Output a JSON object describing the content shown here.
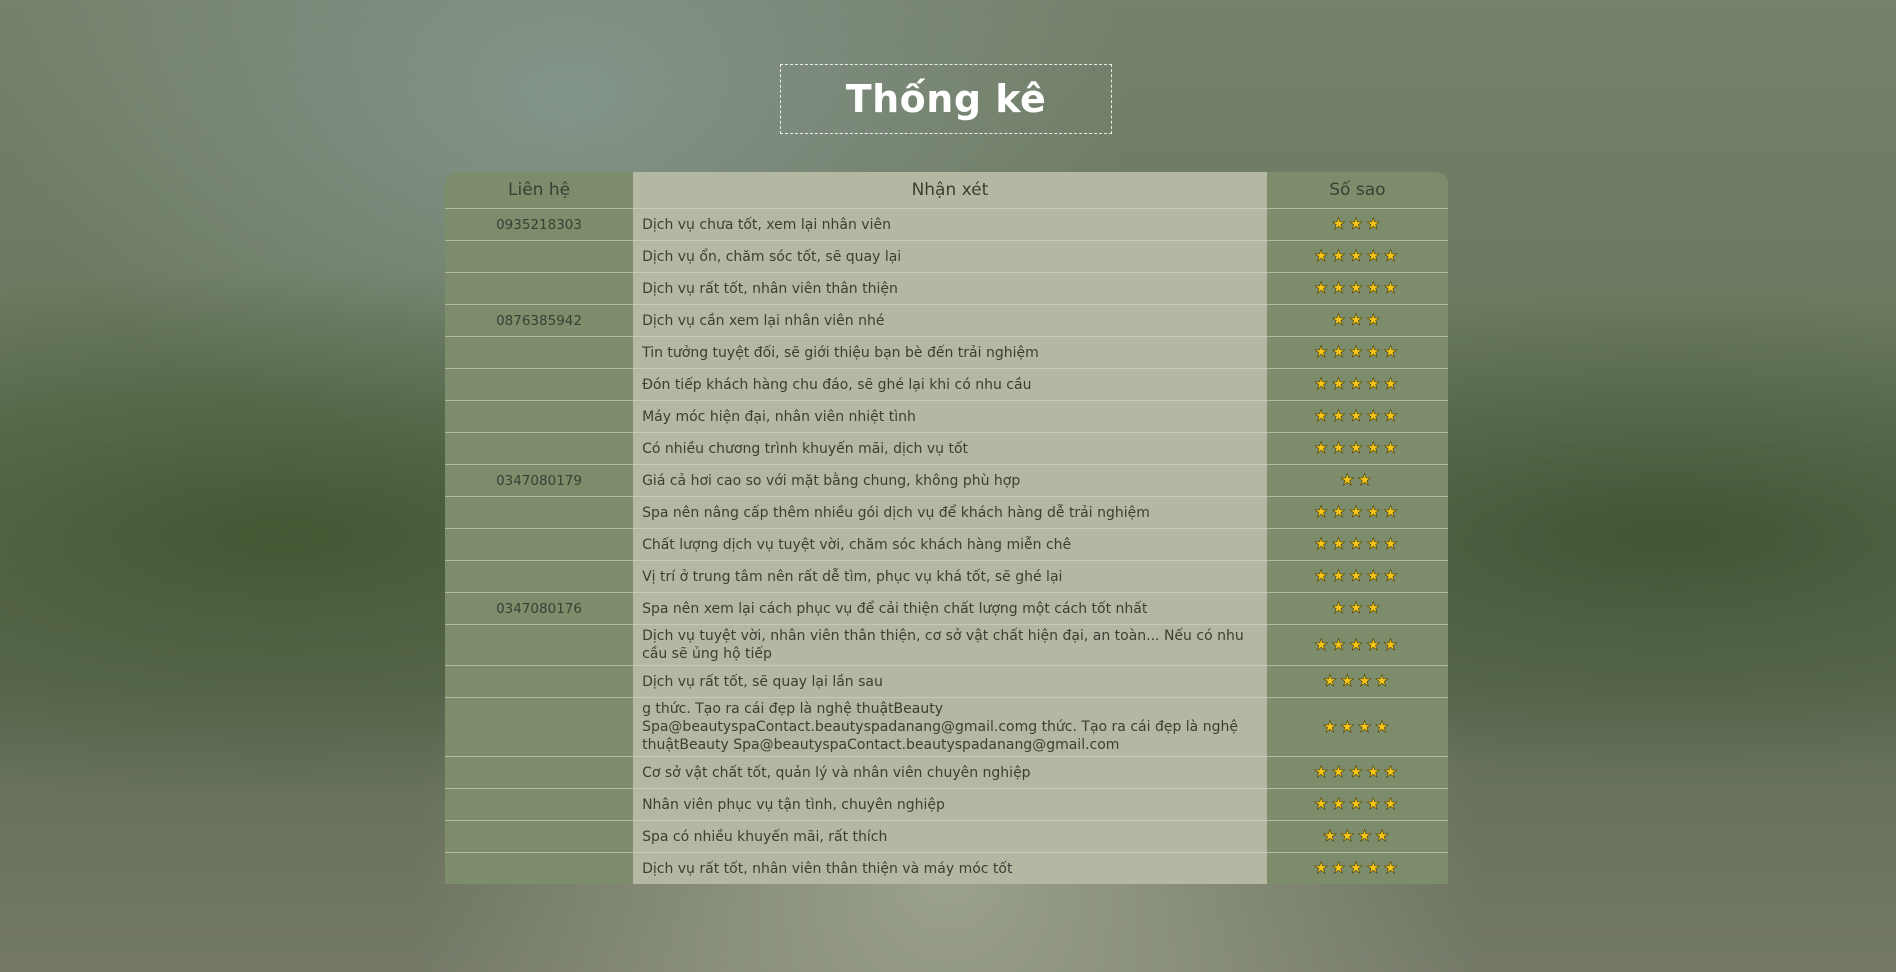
{
  "page": {
    "title": "Thống kê"
  },
  "table": {
    "headers": {
      "contact": "Liên hệ",
      "review": "Nhận xét",
      "stars": "Số sao"
    },
    "rows": [
      {
        "contact": "0935218303",
        "review": "Dịch vụ chưa tốt, xem lại nhân viên",
        "stars": 3,
        "stars_text": "★★★"
      },
      {
        "contact": "",
        "review": "Dịch vụ ổn, chăm sóc tốt, sẽ quay lại",
        "stars": 5,
        "stars_text": "★★★★★"
      },
      {
        "contact": "",
        "review": "Dịch vụ rất tốt, nhân viên thân thiện",
        "stars": 5,
        "stars_text": "★★★★★"
      },
      {
        "contact": "0876385942",
        "review": "Dịch vụ cần xem lại nhân viên nhé",
        "stars": 3,
        "stars_text": "★★★"
      },
      {
        "contact": "",
        "review": "Tin tưởng tuyệt đối, sẽ giới thiệu bạn bè đến trải nghiệm",
        "stars": 5,
        "stars_text": "★★★★★"
      },
      {
        "contact": "",
        "review": "Đón tiếp khách hàng chu đáo, sẽ ghé lại khi có nhu cầu",
        "stars": 5,
        "stars_text": "★★★★★"
      },
      {
        "contact": "",
        "review": "Máy móc hiện đại, nhân viên nhiệt tình",
        "stars": 5,
        "stars_text": "★★★★★"
      },
      {
        "contact": "",
        "review": "Có nhiều chương trình khuyến mãi, dịch vụ tốt",
        "stars": 5,
        "stars_text": "★★★★★"
      },
      {
        "contact": "0347080179",
        "review": "Giá cả hơi cao so với mặt bằng chung, không phù hợp",
        "stars": 2,
        "stars_text": "★★"
      },
      {
        "contact": "",
        "review": "Spa nên nâng cấp thêm nhiều gói dịch vụ để khách hàng dễ trải nghiệm",
        "stars": 5,
        "stars_text": "★★★★★"
      },
      {
        "contact": "",
        "review": "Chất lượng dịch vụ tuyệt vời, chăm sóc khách hàng miễn chê",
        "stars": 5,
        "stars_text": "★★★★★"
      },
      {
        "contact": "",
        "review": "Vị trí ở trung tâm nên rất dễ tìm, phục vụ khá tốt, sẽ ghé lại",
        "stars": 5,
        "stars_text": "★★★★★"
      },
      {
        "contact": "0347080176",
        "review": "Spa nên xem lại cách phục vụ để cải thiện chất lượng một cách tốt nhất",
        "stars": 3,
        "stars_text": "★★★"
      },
      {
        "contact": "",
        "review": "Dịch vụ tuyệt vời, nhân viên thân thiện, cơ sở vật chất hiện đại, an toàn... Nếu có nhu cầu sẽ ủng hộ tiếp",
        "stars": 5,
        "stars_text": "★★★★★"
      },
      {
        "contact": "",
        "review": "Dịch vụ rất tốt, sẽ quay lại lần sau",
        "stars": 4,
        "stars_text": "★★★★"
      },
      {
        "contact": "",
        "review": "g thức. Tạo ra cái đẹp là nghệ thuậtBeauty Spa@beautyspaContact.beautyspadanang@gmail.comg thức. Tạo ra cái đẹp là nghệ thuậtBeauty Spa@beautyspaContact.beautyspadanang@gmail.com",
        "stars": 4,
        "stars_text": "★★★★"
      },
      {
        "contact": "",
        "review": "Cơ sở vật chất tốt, quản lý và nhân viên chuyên nghiệp",
        "stars": 5,
        "stars_text": "★★★★★"
      },
      {
        "contact": "",
        "review": "Nhân viên phục vụ tận tình, chuyên nghiệp",
        "stars": 5,
        "stars_text": "★★★★★"
      },
      {
        "contact": "",
        "review": "Spa có nhiều khuyến mãi, rất thích",
        "stars": 4,
        "stars_text": "★★★★"
      },
      {
        "contact": "",
        "review": "Dịch vụ rất tốt, nhân viên thân thiện và máy móc tốt",
        "stars": 5,
        "stars_text": "★★★★★"
      }
    ]
  },
  "colors": {
    "side_column": "#7d8d6b",
    "center_column": "#b4b8a3",
    "star": "#f5c518",
    "title_text": "#ffffff"
  }
}
